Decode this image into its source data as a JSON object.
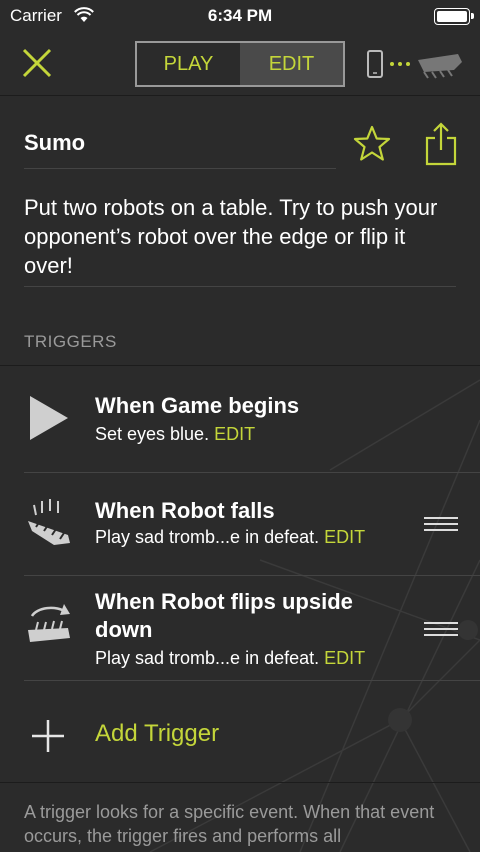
{
  "status_bar": {
    "carrier": "Carrier",
    "time": "6:34 PM"
  },
  "nav": {
    "tabs": [
      {
        "label": "PLAY",
        "active": false
      },
      {
        "label": "EDIT",
        "active": true
      }
    ],
    "close_icon": "close-x-icon",
    "connect_icon": "phone-robot-connect-icon"
  },
  "program": {
    "title": "Sumo",
    "description": "Put two robots on a table. Try to push your opponent’s robot over the edge or flip it over!"
  },
  "triggers_section": {
    "header": "TRIGGERS",
    "items": [
      {
        "title": "When Game begins",
        "subtitle": "Set eyes blue.",
        "edit": "EDIT",
        "icon": "play-icon",
        "reorderable": false
      },
      {
        "title": "When Robot falls",
        "subtitle": "Play sad tromb...e in defeat.",
        "edit": "EDIT",
        "icon": "robot-falls-icon",
        "reorderable": true
      },
      {
        "title": "When Robot flips upside down",
        "subtitle": "Play sad tromb...e in defeat.",
        "edit": "EDIT",
        "icon": "robot-flips-icon",
        "reorderable": true
      }
    ],
    "add_label": "Add Trigger"
  },
  "footer": {
    "text": "A trigger looks for a specific event. When that event occurs, the trigger fires and performs all"
  },
  "colors": {
    "background": "#2b2b2b",
    "accent": "#c4d63a",
    "muted_text": "#9a9a9a"
  }
}
